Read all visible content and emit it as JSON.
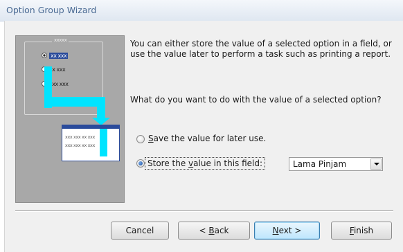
{
  "window": {
    "title": "Option Group Wizard"
  },
  "illustration": {
    "caption": "xxxxx",
    "options": [
      "xx xxx",
      "xx xxx",
      "xxx xxx"
    ],
    "table_rows": [
      "xxx xxx xx xxx",
      "xxx xxx xx xxx"
    ]
  },
  "description": "You can either store the value of a selected option in a field, or use the value later to perform a task such as printing a report.",
  "question": "What do you want to do with the value of a selected option?",
  "options": {
    "save": {
      "prefix": "",
      "mnemonic": "S",
      "suffix": "ave the value for later use.",
      "selected": false
    },
    "store": {
      "prefix": "Store the ",
      "mnemonic": "v",
      "suffix": "alue in this field:",
      "selected": true
    }
  },
  "field_combo": {
    "value": "Lama Pinjam"
  },
  "buttons": {
    "cancel": {
      "label": "Cancel"
    },
    "back": {
      "prefix": "< ",
      "mnemonic": "B",
      "suffix": "ack"
    },
    "next": {
      "prefix": "",
      "mnemonic": "N",
      "suffix": "ext >"
    },
    "finish": {
      "prefix": "",
      "mnemonic": "F",
      "suffix": "inish"
    }
  },
  "colors": {
    "accent": "#00e4ff",
    "selection": "#2a4b9b",
    "title_text": "#4a6a93"
  }
}
